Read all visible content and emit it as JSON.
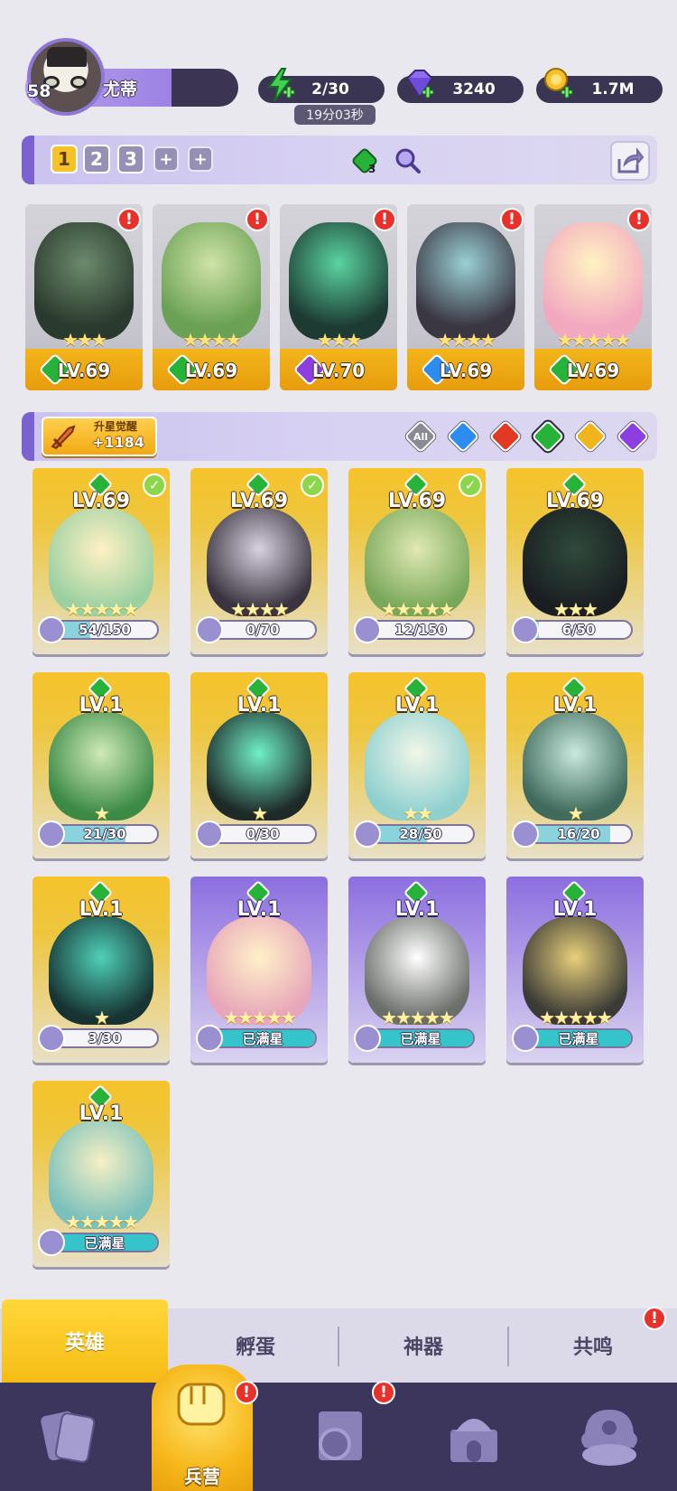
{
  "player": {
    "level": "58",
    "name": "尤蒂"
  },
  "resources": {
    "energy": "2/30",
    "energy_timer": "19分03秒",
    "gems": "3240",
    "gold": "1.7M"
  },
  "team_bar": {
    "tabs": [
      "1",
      "2",
      "3"
    ],
    "element_count": "3"
  },
  "team": [
    {
      "level": "LV.69",
      "stars": "★★★",
      "element": "nature",
      "color": "#27b23a",
      "alert": "!"
    },
    {
      "level": "LV.69",
      "stars": "★★★★",
      "element": "nature",
      "color": "#27b23a",
      "alert": "!"
    },
    {
      "level": "LV.70",
      "stars": "★★★",
      "element": "dark",
      "color": "#8c3fe0",
      "alert": "!"
    },
    {
      "level": "LV.69",
      "stars": "★★★★",
      "element": "water",
      "color": "#2d8cf0",
      "alert": "!"
    },
    {
      "level": "LV.69",
      "stars": "★★★★★",
      "element": "nature",
      "color": "#27b23a",
      "alert": "!"
    }
  ],
  "awaken": {
    "title": "升星觉醒",
    "value": "+1184"
  },
  "filters": [
    {
      "name": "all",
      "label": "All",
      "color": "#8a8a94"
    },
    {
      "name": "water",
      "label": "",
      "color": "#2d8cf0"
    },
    {
      "name": "fire",
      "label": "",
      "color": "#e23a22"
    },
    {
      "name": "nature",
      "label": "",
      "color": "#27b23a"
    },
    {
      "name": "light",
      "label": "",
      "color": "#f0b41c"
    },
    {
      "name": "dark",
      "label": "",
      "color": "#8c3fe0"
    }
  ],
  "heroes": [
    {
      "level": "LV.69",
      "progress": "54/150",
      "fraction": 0.36,
      "stars": "★★★★★",
      "theme": "yellow",
      "checked": true
    },
    {
      "level": "LV.69",
      "progress": "0/70",
      "fraction": 0.0,
      "stars": "★★★★",
      "theme": "yellow",
      "checked": true
    },
    {
      "level": "LV.69",
      "progress": "12/150",
      "fraction": 0.08,
      "stars": "★★★★★",
      "theme": "yellow",
      "checked": true
    },
    {
      "level": "LV.69",
      "progress": "6/50",
      "fraction": 0.12,
      "stars": "★★★",
      "theme": "yellow",
      "checked": false
    },
    {
      "level": "LV.1",
      "progress": "21/30",
      "fraction": 0.7,
      "stars": "★",
      "theme": "yellow",
      "checked": false
    },
    {
      "level": "LV.1",
      "progress": "0/30",
      "fraction": 0.0,
      "stars": "★",
      "theme": "yellow",
      "checked": false
    },
    {
      "level": "LV.1",
      "progress": "28/50",
      "fraction": 0.56,
      "stars": "★★",
      "theme": "yellow",
      "checked": false
    },
    {
      "level": "LV.1",
      "progress": "16/20",
      "fraction": 0.8,
      "stars": "★",
      "theme": "yellow",
      "checked": false
    },
    {
      "level": "LV.1",
      "progress": "3/30",
      "fraction": 0.1,
      "stars": "★",
      "theme": "yellow",
      "checked": false
    },
    {
      "level": "LV.1",
      "progress": "已满星",
      "fraction": 1.0,
      "stars": "★★★★★",
      "theme": "purple",
      "checked": false
    },
    {
      "level": "LV.1",
      "progress": "已满星",
      "fraction": 1.0,
      "stars": "★★★★★",
      "theme": "purple",
      "checked": false
    },
    {
      "level": "LV.1",
      "progress": "已满星",
      "fraction": 1.0,
      "stars": "★★★★★",
      "theme": "purple",
      "checked": false
    },
    {
      "level": "LV.1",
      "progress": "已满星",
      "fraction": 1.0,
      "stars": "★★★★★",
      "theme": "yellow",
      "checked": false
    }
  ],
  "subtabs": {
    "heroes": "英雄",
    "incubate": "孵蛋",
    "artifact": "神器",
    "resonance": "共鸣"
  },
  "nav": {
    "barracks": "兵营"
  },
  "alerts": {
    "mark": "!"
  },
  "colors": {
    "accent": "#f6c22a",
    "panel": "#3c355c",
    "alert": "#e8312b"
  }
}
